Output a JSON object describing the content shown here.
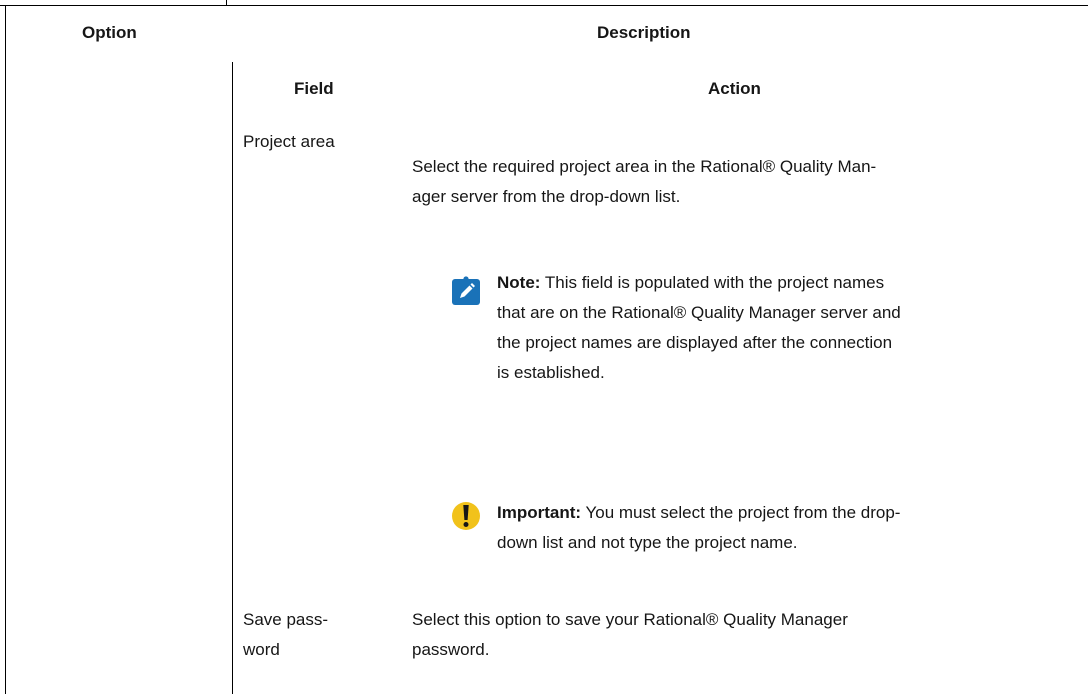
{
  "table": {
    "header": {
      "option": "Option",
      "description": "Description"
    },
    "nested": {
      "field_header": "Field",
      "action_header": "Action",
      "rows": [
        {
          "field_line1": "Project area",
          "action_text": "Select the required project area in the Rational® Quality Man-",
          "action_text2": "ager server from the drop-down list.",
          "note": {
            "label": "Note:",
            "line1": " This field is populated with the project names",
            "line2": "that are on the Rational® Quality Manager server and",
            "line3": "the project names are displayed after the connection",
            "line4": "is established.",
            "icon": "pencil-icon",
            "icon_color": "#1a72b8"
          },
          "important": {
            "label": "Important:",
            "line1": " You must select the project from the drop-",
            "line2": "down list and not type the project name.",
            "icon": "exclamation-icon",
            "icon_color": "#f1c21b"
          }
        },
        {
          "field_line1": "Save pass-",
          "field_line2": "word",
          "action_text": "Select this option to save your Rational® Quality Manager",
          "action_text2": "password."
        }
      ]
    }
  }
}
